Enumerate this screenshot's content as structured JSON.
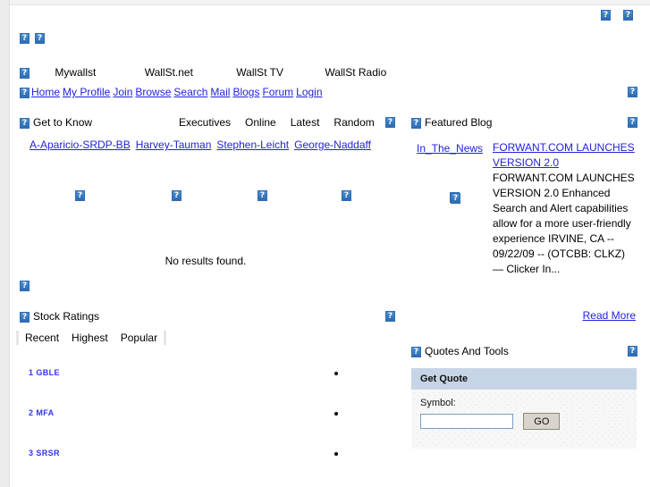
{
  "header": {
    "top_icons": [
      "broken-image",
      "broken-image"
    ],
    "logo_icons": [
      "broken-image",
      "broken-image"
    ],
    "site_nav": [
      {
        "label": "Mywallst"
      },
      {
        "label": "WallSt.net"
      },
      {
        "label": "WallSt TV"
      },
      {
        "label": "WallSt Radio"
      }
    ],
    "links": [
      {
        "label": "Home"
      },
      {
        "label": "My Profile"
      },
      {
        "label": "Join"
      },
      {
        "label": "Browse"
      },
      {
        "label": "Search"
      },
      {
        "label": "Mail"
      },
      {
        "label": "Blogs"
      },
      {
        "label": "Forum"
      },
      {
        "label": "Login"
      }
    ]
  },
  "get_to_know": {
    "title": "Get to Know",
    "filters": [
      {
        "label": "Executives"
      },
      {
        "label": "Online"
      },
      {
        "label": "Latest"
      },
      {
        "label": "Random"
      }
    ],
    "names": [
      {
        "label": "A-Aparicio-SRDP-BB"
      },
      {
        "label": "Harvey-Tauman"
      },
      {
        "label": "Stephen-Leicht"
      },
      {
        "label": "George-Naddaff"
      }
    ],
    "empty_message": "No results found."
  },
  "stock_ratings": {
    "title": "Stock Ratings",
    "tabs": [
      {
        "label": "Recent",
        "active": true
      },
      {
        "label": "Highest",
        "active": false
      },
      {
        "label": "Popular",
        "active": false
      }
    ],
    "rows": [
      {
        "rank": "1",
        "symbol": "GBLE"
      },
      {
        "rank": "2",
        "symbol": "MFA"
      },
      {
        "rank": "3",
        "symbol": "SRSR"
      }
    ]
  },
  "featured_blog": {
    "title": "Featured Blog",
    "author": "In_The_News",
    "post_title": "FORWANT.COM LAUNCHES VERSION 2.0 ",
    "summary": "FORWANT.COM LAUNCHES VERSION 2.0 Enhanced Search and Alert capabilities allow for a more user-friendly experience   IRVINE, CA -- 09/22/09 -- (OTCBB: CLKZ) — Clicker In...",
    "read_more": "Read More"
  },
  "quotes_and_tools": {
    "title": "Quotes And Tools",
    "get_quote": {
      "box_title": "Get Quote",
      "symbol_label": "Symbol:",
      "symbol_value": "",
      "symbol_placeholder": "",
      "go_label": "GO"
    }
  },
  "colors": {
    "link": "#2222dd",
    "symbol_link": "#3333ee",
    "panel_header": "#c6d5e6",
    "button_face": "#d8d4cb",
    "gutter": "#ececec"
  }
}
